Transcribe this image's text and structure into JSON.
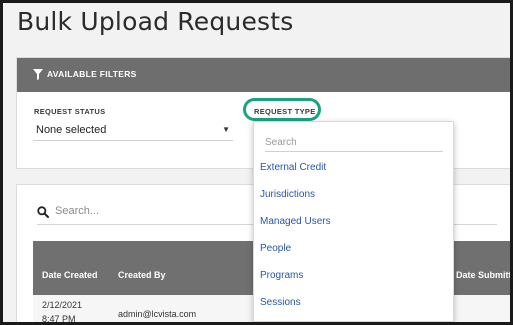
{
  "page": {
    "title": "Bulk Upload Requests"
  },
  "filters": {
    "header": "AVAILABLE FILTERS",
    "request_status": {
      "label": "REQUEST STATUS",
      "value": "None selected"
    },
    "request_type": {
      "label": "REQUEST TYPE"
    }
  },
  "request_type_dropdown": {
    "search_placeholder": "Search",
    "options": [
      "External Credit",
      "Jurisdictions",
      "Managed Users",
      "People",
      "Programs",
      "Sessions"
    ]
  },
  "requests": {
    "search_placeholder": "Search...",
    "columns": [
      "Date Created",
      "Created By",
      "Date Submitt"
    ],
    "rows": [
      {
        "date_created": "2/12/2021",
        "time_created": "8:47 PM",
        "created_by": "admin@lcvista.com"
      }
    ]
  },
  "colors": {
    "header_bg": "#6e6e6e",
    "highlight": "#1aa37f",
    "link": "#2757a8"
  },
  "icons": {
    "filters": "filter-funnel-icon",
    "search": "search-icon",
    "caret": "caret-down-icon"
  }
}
